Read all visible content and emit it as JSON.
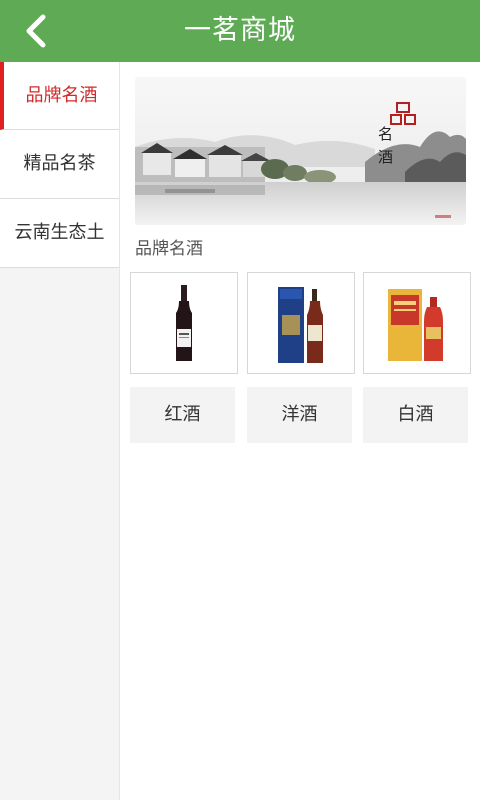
{
  "header": {
    "title": "一茗商城",
    "back_icon": "chevron-left-icon",
    "background_color": "#5faa55"
  },
  "sidebar": {
    "active_color": "#e02020",
    "items": [
      {
        "label": "品牌名酒",
        "active": true
      },
      {
        "label": "精品名茶",
        "active": false
      },
      {
        "label": "云南生态土",
        "active": false
      }
    ]
  },
  "banner": {
    "seal_text": "品",
    "calligraphy": [
      "名",
      "酒"
    ]
  },
  "section": {
    "title": "品牌名酒"
  },
  "products": [
    {
      "name": "red-wine-bottle-image",
      "icon": "wine-bottle-icon"
    },
    {
      "name": "foreign-liquor-image",
      "icon": "liquor-bottle-icon"
    },
    {
      "name": "baijiu-image",
      "icon": "baijiu-bottle-icon"
    }
  ],
  "categories": [
    {
      "label": "红酒"
    },
    {
      "label": "洋酒"
    },
    {
      "label": "白酒"
    }
  ]
}
